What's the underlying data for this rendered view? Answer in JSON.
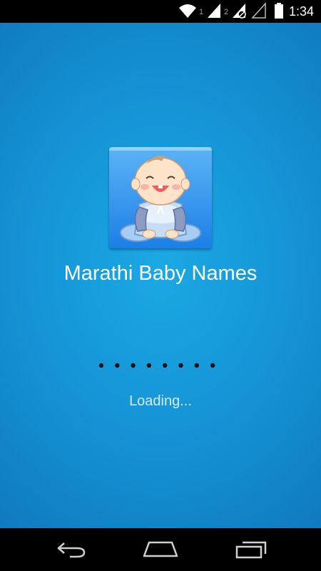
{
  "status_bar": {
    "time": "1:34",
    "sim1_label": "1",
    "sim2_label": "2",
    "icons": [
      "wifi-icon",
      "signal-icon",
      "signal-icon",
      "signal-icon",
      "battery-icon"
    ]
  },
  "splash": {
    "app_title": "Marathi Baby Names",
    "loading_text": "Loading...",
    "loading_dots_count": 8,
    "app_icon": "baby-icon"
  },
  "nav_bar": {
    "icons": [
      "back-icon",
      "home-icon",
      "recent-apps-icon"
    ]
  },
  "colors": {
    "background_center": "#1aa9e4",
    "background_edge": "#0d74b7",
    "title_text": "#ffffff",
    "loading_text": "#d6ecf7",
    "bars": "#000000"
  }
}
